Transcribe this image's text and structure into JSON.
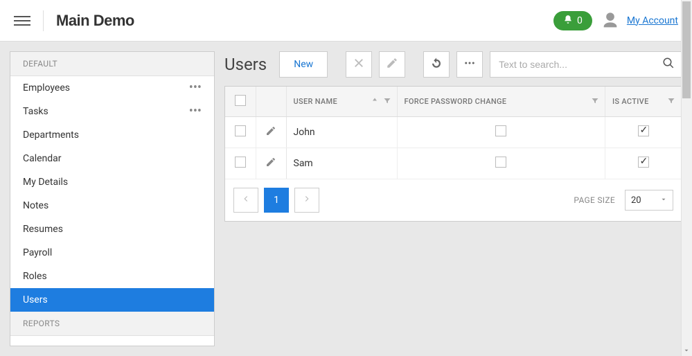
{
  "header": {
    "app_title": "Main Demo",
    "notification_count": "0",
    "account_link": "My Account"
  },
  "sidebar": {
    "sections": [
      {
        "label": "DEFAULT",
        "items": [
          {
            "label": "Employees",
            "has_more": true,
            "active": false
          },
          {
            "label": "Tasks",
            "has_more": true,
            "active": false
          },
          {
            "label": "Departments",
            "has_more": false,
            "active": false
          },
          {
            "label": "Calendar",
            "has_more": false,
            "active": false
          },
          {
            "label": "My Details",
            "has_more": false,
            "active": false
          },
          {
            "label": "Notes",
            "has_more": false,
            "active": false
          },
          {
            "label": "Resumes",
            "has_more": false,
            "active": false
          },
          {
            "label": "Payroll",
            "has_more": false,
            "active": false
          },
          {
            "label": "Roles",
            "has_more": false,
            "active": false
          },
          {
            "label": "Users",
            "has_more": false,
            "active": true
          }
        ]
      },
      {
        "label": "REPORTS",
        "items": []
      }
    ]
  },
  "main": {
    "page_title": "Users",
    "toolbar": {
      "new_label": "New"
    },
    "search": {
      "placeholder": "Text to search...",
      "value": ""
    },
    "table": {
      "columns": {
        "username": "USER NAME",
        "force_pw": "FORCE PASSWORD CHANGE",
        "is_active": "IS ACTIVE"
      },
      "rows": [
        {
          "username": "John",
          "force_password_change": false,
          "is_active": true
        },
        {
          "username": "Sam",
          "force_password_change": false,
          "is_active": true
        }
      ]
    },
    "pager": {
      "current_page": "1",
      "page_size_label": "PAGE SIZE",
      "page_size_value": "20"
    }
  }
}
